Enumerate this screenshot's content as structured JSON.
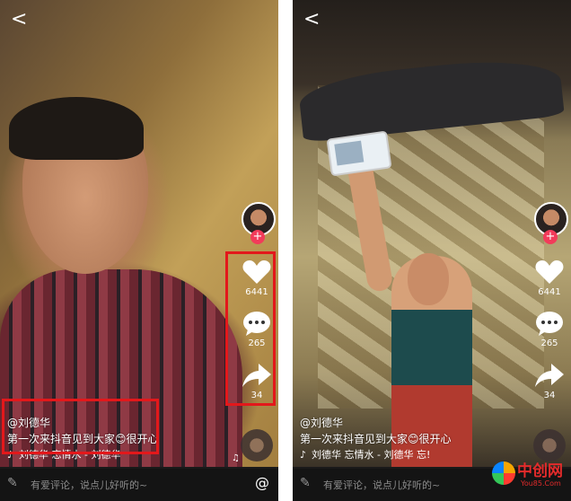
{
  "left": {
    "back_glyph": "<",
    "likes": "6441",
    "comments": "265",
    "shares": "34",
    "username": "@刘德华",
    "caption": "第一次来抖音见到大家😊很开心",
    "music": "刘德华   忘情水 - 刘德华",
    "comment_placeholder": "有爱评论，说点儿好听的~",
    "at_glyph": "@"
  },
  "right": {
    "back_glyph": "<",
    "likes": "6441",
    "comments": "265",
    "shares": "34",
    "username": "@刘德华",
    "caption": "第一次来抖音见到大家😊很开心",
    "music": "刘德华   忘情水 - 刘德华   忘!",
    "comment_placeholder": "有爱评论，说点儿好听的~",
    "at_glyph": "@"
  },
  "watermark": {
    "title": "中创网",
    "sub": "You85.Com"
  },
  "colors": {
    "highlight_box": "#e3181b",
    "follow_badge": "#f23b5a",
    "bottom_bar": "#141414"
  },
  "icons": [
    "back-arrow-icon",
    "heart-icon",
    "comment-icon",
    "share-icon",
    "music-note-icon",
    "pen-icon",
    "at-icon"
  ]
}
